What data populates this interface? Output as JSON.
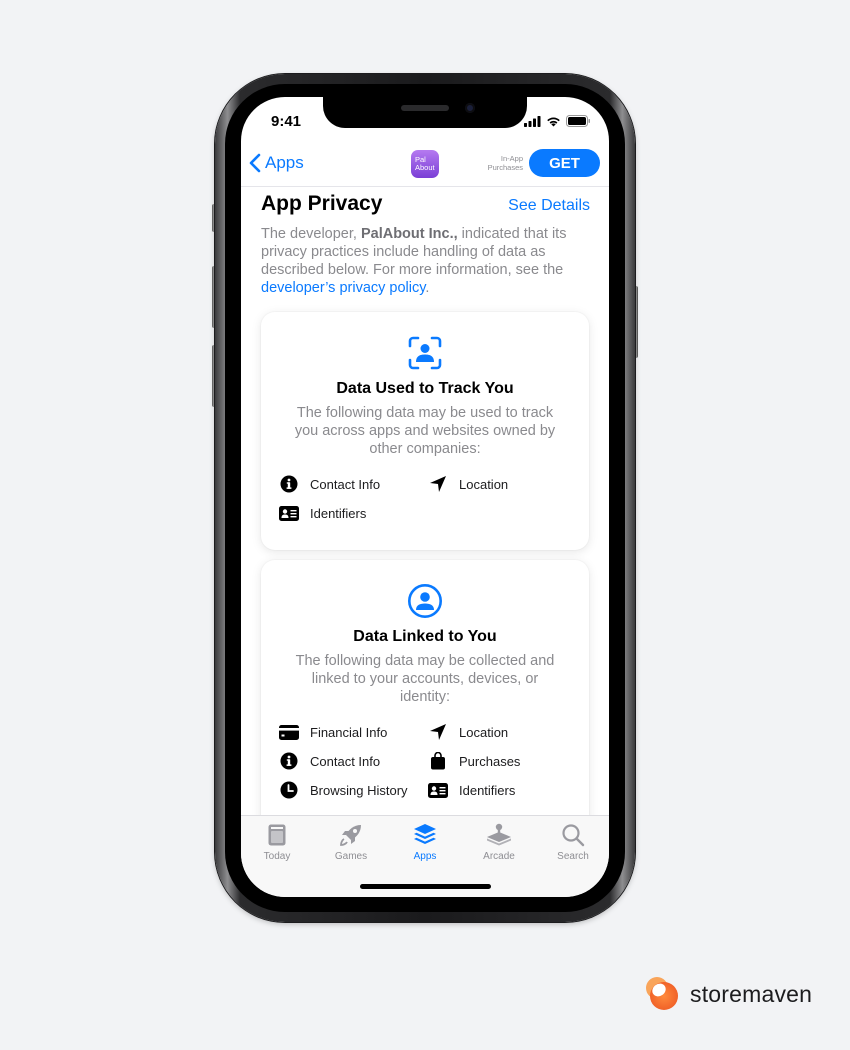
{
  "status_bar": {
    "time": "9:41"
  },
  "navbar": {
    "back_label": "Apps",
    "app_icon_text_line1": "Pal",
    "app_icon_text_line2": "About",
    "iap_line1": "In-App",
    "iap_line2": "Purchases",
    "get_label": "GET"
  },
  "privacy": {
    "title": "App Privacy",
    "see_details": "See Details",
    "desc_prefix": "The developer, ",
    "developer": "PalAbout Inc.,",
    "desc_suffix": " indicated that its privacy practices include handling of data as described below. For more information, see the ",
    "policy_link": "developer’s privacy policy",
    "desc_end": "."
  },
  "cards": [
    {
      "icon": "tracking-person-icon",
      "title": "Data Used to Track You",
      "description": "The following data may be used to track you across apps and websites owned by other companies:",
      "items": [
        {
          "icon": "info-circle-icon",
          "label": "Contact Info"
        },
        {
          "icon": "location-arrow-icon",
          "label": "Location"
        },
        {
          "icon": "id-card-icon",
          "label": "Identifiers"
        }
      ]
    },
    {
      "icon": "person-circle-icon",
      "title": "Data Linked to You",
      "description": "The following data may be collected and linked to your accounts, devices, or identity:",
      "items": [
        {
          "icon": "credit-card-icon",
          "label": "Financial Info"
        },
        {
          "icon": "location-arrow-icon",
          "label": "Location"
        },
        {
          "icon": "info-circle-icon",
          "label": "Contact Info"
        },
        {
          "icon": "shopping-bag-icon",
          "label": "Purchases"
        },
        {
          "icon": "clock-icon",
          "label": "Browsing History"
        },
        {
          "icon": "id-card-icon",
          "label": "Identifiers"
        }
      ]
    }
  ],
  "tabbar": {
    "tabs": [
      {
        "label": "Today",
        "icon": "today-icon",
        "active": false
      },
      {
        "label": "Games",
        "icon": "rocket-icon",
        "active": false
      },
      {
        "label": "Apps",
        "icon": "layers-icon",
        "active": true
      },
      {
        "label": "Arcade",
        "icon": "joystick-icon",
        "active": false
      },
      {
        "label": "Search",
        "icon": "search-icon",
        "active": false
      }
    ]
  },
  "colors": {
    "accent": "#0a7aff",
    "background": "#f2f3f5",
    "brand_orange": "#f26b2f"
  },
  "brand": {
    "name": "storemaven"
  }
}
